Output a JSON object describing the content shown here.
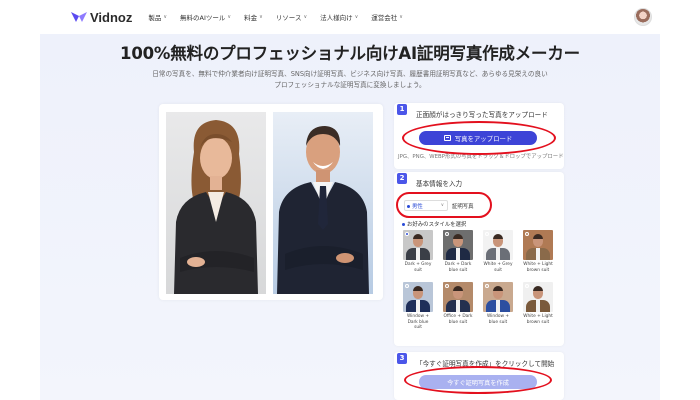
{
  "nav": {
    "logo": "Vidnoz",
    "menu": [
      {
        "label": "製品"
      },
      {
        "label": "無料のAIツール"
      },
      {
        "label": "料金"
      },
      {
        "label": "リソース"
      },
      {
        "label": "法人様向け"
      },
      {
        "label": "運営会社"
      }
    ]
  },
  "hero": {
    "title": "100%無料のプロフェッショナル向けAI証明写真作成メーカー",
    "subtitle_line1": "日常の写真を、無料で仲介業者向け証明写真、SNS向け証明写真、ビジネス向け写真、履歴書用証明写真など、あらゆる見栄えの良い",
    "subtitle_line2": "プロフェッショナルな証明写真に変換しましょう。"
  },
  "steps": {
    "step1": {
      "number": "1",
      "label": "正面顔がはっきり写った写真をアップロード",
      "button": "写真をアップロード",
      "hint": "JPG、PNG、WEBP形式の写真をドラッグ＆ドロップでアップロード"
    },
    "step2": {
      "number": "2",
      "label": "基本情報を入力",
      "gender": "男性",
      "photo_type": "証明写真",
      "style_title": "お好みのスタイルを選択",
      "styles": [
        {
          "line1": "Dark + Grey",
          "line2": "suit",
          "suit": "#3b3f47",
          "bg": "#c8c8c8",
          "selected": true
        },
        {
          "line1": "Dark + Dark",
          "line2": "blue suit",
          "suit": "#1f2a44",
          "bg": "#6e6e6e",
          "selected": false
        },
        {
          "line1": "White + Grey",
          "line2": "suit",
          "suit": "#6b6f77",
          "bg": "#f2f2f2",
          "selected": false
        },
        {
          "line1": "White + Light",
          "line2": "brown suit",
          "suit": "#8a6a4a",
          "bg": "#b07a54",
          "selected": false
        },
        {
          "line1": "Window +",
          "line2": "Dark blue suit",
          "suit": "#1f2f5a",
          "bg": "#b9c6d8",
          "selected": false
        },
        {
          "line1": "Office + Dark",
          "line2": "blue suit",
          "suit": "#25304f",
          "bg": "#b48a6a",
          "selected": false
        },
        {
          "line1": "Window +",
          "line2": "blue suit",
          "suit": "#2d4fa0",
          "bg": "#c9a98f",
          "selected": false
        },
        {
          "line1": "White + Light",
          "line2": "brown suit",
          "suit": "#7a5a3c",
          "bg": "#f0f0f0",
          "selected": false
        }
      ]
    },
    "step3": {
      "number": "3",
      "label": "「今すぐ証明写真を作成」をクリックして開始",
      "button": "今すぐ証明写真を作成"
    }
  },
  "colors": {
    "accent": "#3d44d7",
    "highlight": "#e3101e",
    "band": "#eef1fb"
  }
}
